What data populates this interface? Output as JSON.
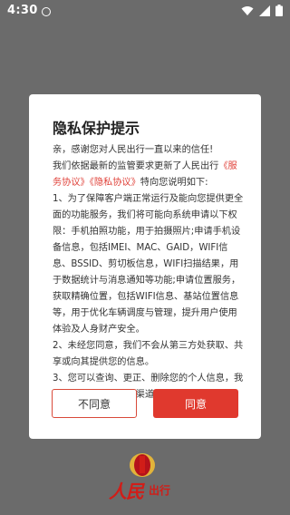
{
  "status": {
    "time": "4:30"
  },
  "dialog": {
    "title": "隐私保护提示",
    "greeting": "亲，感谢您对人民出行一直以来的信任!",
    "intro_before": "我们依据最新的监管要求更新了人民出行",
    "service_link": "《服务协议》",
    "privacy_link": "《隐私协议》",
    "intro_after": "特向您说明如下:",
    "item1": "1、为了保障客户端正常运行及能向您提供更全面的功能服务，我们将可能向系统申请以下权限：手机拍照功能，用于拍摄照片;申请手机设备信息，包括IMEI、MAC、GAID，WIFI信息、BSSID、剪切板信息，WIFI扫描结果，用于数据统计与消息通知等功能;申请位置服务，获取精确位置，包括WIFI信息、基站位置信息等，用于优化车辆调度与管理，提升用户使用体验及人身财产安全。",
    "item2": "2、未经您同意，我们不会从第三方处获取、共享或向其提供您的信息。",
    "item3": "3、您可以查询、更正、删除您的个人信息，我们也提供账户注销的渠道。",
    "disagree_label": "不同意",
    "agree_label": "同意"
  },
  "logo": {
    "script": "人民",
    "text": "出行"
  },
  "colors": {
    "overlay": "#6b6b6b",
    "accent": "#e0392e",
    "link": "#e0423a",
    "logo_red": "#d11d18",
    "logo_gold": "#e2b33a"
  }
}
